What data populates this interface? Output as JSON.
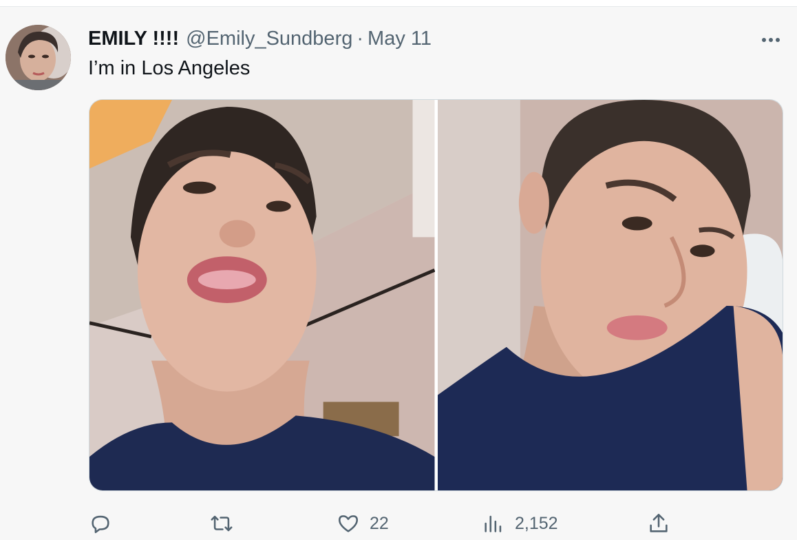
{
  "tweet": {
    "author": {
      "display_name": "EMILY !!!!",
      "handle": "@Emily_Sundberg",
      "avatar_icon": "profile-photo"
    },
    "separator": "·",
    "date": "May 11",
    "text": "I’m in Los Angeles",
    "media": [
      {
        "description_icon": "selfie-photo"
      },
      {
        "description_icon": "selfie-photo"
      }
    ],
    "actions": {
      "reply": {
        "icon": "reply-icon",
        "count": ""
      },
      "retweet": {
        "icon": "retweet-icon",
        "count": ""
      },
      "like": {
        "icon": "heart-icon",
        "count": "22"
      },
      "views": {
        "icon": "analytics-icon",
        "count": "2,152"
      },
      "share": {
        "icon": "share-icon",
        "count": ""
      }
    }
  },
  "colors": {
    "secondary_text": "#536471",
    "primary_text": "#0f1419",
    "background": "#f7f7f7",
    "border": "#cfd9de"
  }
}
